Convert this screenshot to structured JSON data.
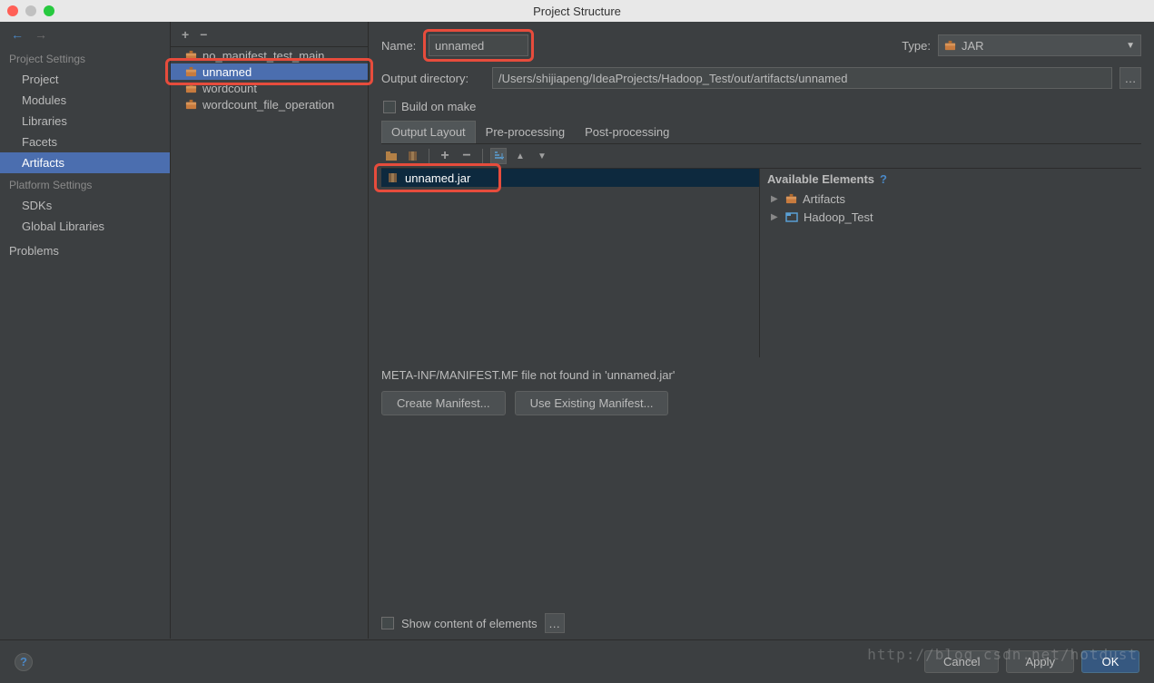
{
  "window": {
    "title": "Project Structure"
  },
  "sidebar": {
    "sections": [
      {
        "title": "Project Settings",
        "items": [
          "Project",
          "Modules",
          "Libraries",
          "Facets",
          "Artifacts"
        ]
      },
      {
        "title": "Platform Settings",
        "items": [
          "SDKs",
          "Global Libraries"
        ]
      }
    ],
    "problems": "Problems",
    "selected": "Artifacts"
  },
  "tree": {
    "items": [
      {
        "label": "no_manifest_test_main"
      },
      {
        "label": "unnamed",
        "selected": true,
        "highlighted": true
      },
      {
        "label": "wordcount"
      },
      {
        "label": "wordcount_file_operation"
      }
    ]
  },
  "form": {
    "name_label": "Name:",
    "name_value": "unnamed",
    "type_label": "Type:",
    "type_value": "JAR",
    "output_dir_label": "Output directory:",
    "output_dir_value": "/Users/shijiapeng/IdeaProjects/Hadoop_Test/out/artifacts/unnamed",
    "build_on_make_label": "Build on make"
  },
  "tabs": {
    "items": [
      "Output Layout",
      "Pre-processing",
      "Post-processing"
    ],
    "active": "Output Layout"
  },
  "output_tree": {
    "items": [
      {
        "label": "unnamed.jar",
        "selected": true,
        "highlighted": true
      }
    ]
  },
  "available": {
    "title": "Available Elements",
    "items": [
      {
        "label": "Artifacts",
        "icon": "jar"
      },
      {
        "label": "Hadoop_Test",
        "icon": "module"
      }
    ]
  },
  "status": {
    "message": "META-INF/MANIFEST.MF file not found in 'unnamed.jar'",
    "create_manifest": "Create Manifest...",
    "use_existing": "Use Existing Manifest..."
  },
  "show_content_label": "Show content of elements",
  "footer": {
    "cancel": "Cancel",
    "apply": "Apply",
    "ok": "OK"
  },
  "watermark": "http://blog.csdn.net/hotdust"
}
